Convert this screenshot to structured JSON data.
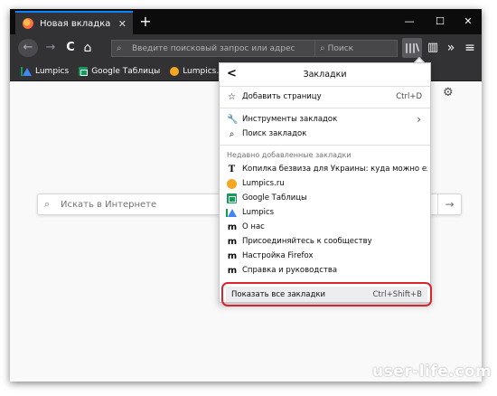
{
  "tab": {
    "title": "Новая вкладка",
    "close": "✕"
  },
  "tabbar": {
    "new_tab": "+",
    "minimize": "—",
    "maximize": "☐",
    "close": "✕"
  },
  "nav": {
    "back": "←",
    "forward": "→",
    "reload": "C",
    "home": "⌂",
    "url_placeholder": "Введите поисковый запрос или адрес",
    "search_placeholder": "Поиск",
    "library": "|||\\",
    "sidebar": "▥",
    "overflow": "»",
    "menu": "≡"
  },
  "bookmarks_toolbar": [
    {
      "label": "Lumpics",
      "icon": "google-drive-icon"
    },
    {
      "label": "Google Таблицы",
      "icon": "google-sheets-icon"
    },
    {
      "label": "Lumpics.ru",
      "icon": "orange-circle-icon"
    }
  ],
  "newtab": {
    "settings": "⚙",
    "search_placeholder": "Искать в Интернете",
    "search_go": "→"
  },
  "panel": {
    "back": "<",
    "title": "Закладки",
    "bookmark_page": {
      "label": "Добавить страницу",
      "shortcut": "Ctrl+D"
    },
    "tools": {
      "label": "Инструменты закладок",
      "arrow": "›"
    },
    "search": {
      "label": "Поиск закладок"
    },
    "recent_header": "Недавно добавленные закладки",
    "recent": [
      {
        "label": "Копилка безвиза для Украины: куда можно ехать хот...",
        "icon": "t-icon",
        "glyph": "T"
      },
      {
        "label": "Lumpics.ru",
        "icon": "orange-circle-icon",
        "glyph": ""
      },
      {
        "label": "Google Таблицы",
        "icon": "google-sheets-icon",
        "glyph": ""
      },
      {
        "label": "Lumpics",
        "icon": "google-drive-icon",
        "glyph": ""
      },
      {
        "label": "О нас",
        "icon": "m-icon",
        "glyph": "m"
      },
      {
        "label": "Присоединяйтесь к сообществу",
        "icon": "m-icon",
        "glyph": "m"
      },
      {
        "label": "Настройка Firefox",
        "icon": "m-icon",
        "glyph": "m"
      },
      {
        "label": "Справка и руководства",
        "icon": "m-icon",
        "glyph": "m"
      }
    ],
    "show_all": {
      "label": "Показать все закладки",
      "shortcut": "Ctrl+Shift+B"
    }
  },
  "watermark": "user-life.com",
  "colors": {
    "highlight_ring": "#d9232d",
    "tab_accent": "#0a84ff",
    "chrome_dark": "#323234"
  }
}
